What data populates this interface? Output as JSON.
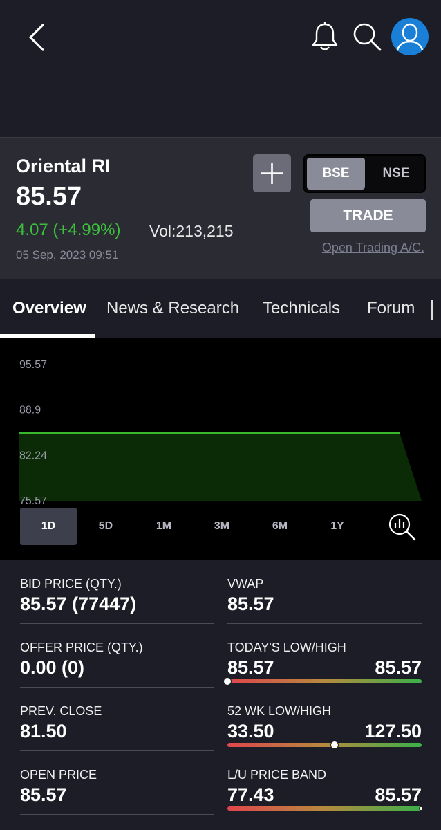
{
  "header": {
    "icons": [
      "back-arrow-icon",
      "bell-icon",
      "search-icon",
      "avatar-icon"
    ]
  },
  "stock": {
    "name": "Oriental RI",
    "price": "85.57",
    "change": "4.07 (+4.99%)",
    "volume": "Vol:213,215",
    "datetime": "05 Sep, 2023 09:51",
    "add_label": "+",
    "exchanges": [
      "BSE",
      "NSE"
    ],
    "selected_exchange": "BSE",
    "trade_label": "TRADE",
    "open_account_label": "Open Trading A/C."
  },
  "tabs": {
    "items": [
      "Overview",
      "News & Research",
      "Technicals",
      "Forum"
    ],
    "active": "Overview"
  },
  "chart_data": {
    "type": "area",
    "y_ticks": [
      "95.57",
      "88.9",
      "82.24",
      "75.57"
    ],
    "ylim": [
      75.57,
      95.57
    ],
    "y_values": [
      85.57,
      85.57,
      85.57
    ],
    "line_color": "#39b82d",
    "fill_color": "#0b2a06",
    "ranges": [
      "1D",
      "5D",
      "1M",
      "3M",
      "6M",
      "1Y"
    ],
    "active_range": "1D"
  },
  "stats": {
    "bid": {
      "label": "BID PRICE (QTY.)",
      "value": "85.57 (77447)"
    },
    "vwap": {
      "label": "VWAP",
      "value": "85.57"
    },
    "offer": {
      "label": "OFFER PRICE (QTY.)",
      "value": "0.00 (0)"
    },
    "today": {
      "label": "TODAY'S LOW/HIGH",
      "low": "85.57",
      "high": "85.57",
      "current_fraction": 0.0
    },
    "prev_close": {
      "label": "PREV. CLOSE",
      "value": "81.50"
    },
    "wk52": {
      "label": "52 WK LOW/HIGH",
      "low": "33.50",
      "high": "127.50",
      "current_fraction": 0.55
    },
    "open": {
      "label": "OPEN PRICE",
      "value": "85.57"
    },
    "band": {
      "label": "L/U PRICE BAND",
      "low": "77.43",
      "high": "85.57",
      "current_fraction": 1.0
    }
  }
}
